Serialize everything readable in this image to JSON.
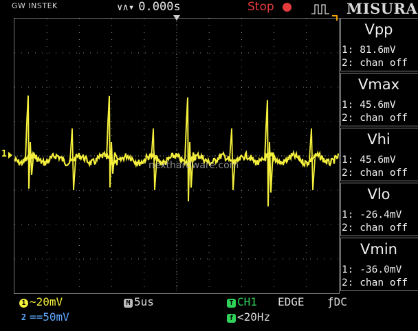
{
  "header": {
    "brand": "GW INSTEK",
    "trigger_position": "0.000s",
    "run_state": "Stop",
    "menu_title": "MISURA"
  },
  "watermark": "nexthardware.com",
  "channel_marker": "1",
  "measurements": [
    {
      "name": "Vpp",
      "ch1": "1: 81.6mV",
      "ch2": "2: chan off"
    },
    {
      "name": "Vmax",
      "ch1": "1: 45.6mV",
      "ch2": "2: chan off"
    },
    {
      "name": "Vhi",
      "ch1": "1: 45.6mV",
      "ch2": "2: chan off"
    },
    {
      "name": "Vlo",
      "ch1": "1: -26.4mV",
      "ch2": "2: chan off"
    },
    {
      "name": "Vmin",
      "ch1": "1: -36.0mV",
      "ch2": "2: chan off"
    }
  ],
  "status_bar": {
    "ch1_badge": "1",
    "ch1_coupling": "~",
    "ch1_scale": "20mV",
    "ch2_badge": "2",
    "ch2_coupling": "==",
    "ch2_scale": "50mV",
    "timebase_badge": "M",
    "timebase": "5us",
    "trigger_badge": "T",
    "trigger_source": "CH1",
    "trigger_type": "EDGE",
    "trigger_coupling": "ƒDC",
    "freq_badge": "f",
    "frequency": "<20Hz"
  },
  "colors": {
    "ch1": "#f4ee3c",
    "ch2": "#5fa8ff",
    "trigger": "#2fd35a",
    "stop": "#e43c3c"
  }
}
